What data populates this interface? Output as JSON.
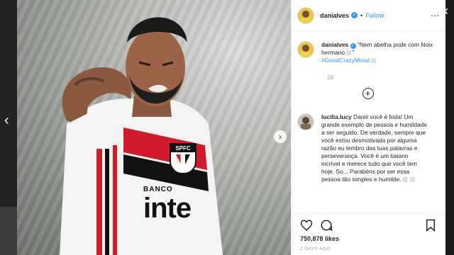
{
  "post": {
    "username": "danialves",
    "follow_label": "Follow",
    "caption_text": "\"Nem abelha pode com Noix hermano◻️\"",
    "caption_hashtag": "#GoodCrazyMood◻️",
    "caption_age": "2d",
    "likes": "750,878 likes",
    "posted": "2 DAYS AGO"
  },
  "comment": {
    "username": "lucilia.lucy",
    "text": "Daniii você é foda! Um grande exemplo de pessoa e humildade a ser seguido. De verdade, sempre que você estou desmotivada por alguma razão eu lembro das tuas palavras e perseverança. Você é um baiano incrível e merece tudo que você tem hoje. So... Parabéns por ser essa pessoa tão simples e humilde.◻️◻️"
  },
  "photo": {
    "jersey_badge": "SPFC",
    "sponsor_top": "BANCO",
    "sponsor_main": "inte",
    "description_icon": "footballer-photo"
  },
  "icons": {
    "close": "close-icon",
    "prev": "chevron-left-icon",
    "next": "chevron-right-icon",
    "like": "heart-icon",
    "comment": "comment-icon",
    "bookmark": "bookmark-icon",
    "add": "plus-circle-icon",
    "more": "more-icon",
    "verified": "verified-icon"
  },
  "colors": {
    "link": "#3897f0",
    "text": "#262626",
    "muted": "#999999",
    "jersey_red": "#d21b2a"
  }
}
